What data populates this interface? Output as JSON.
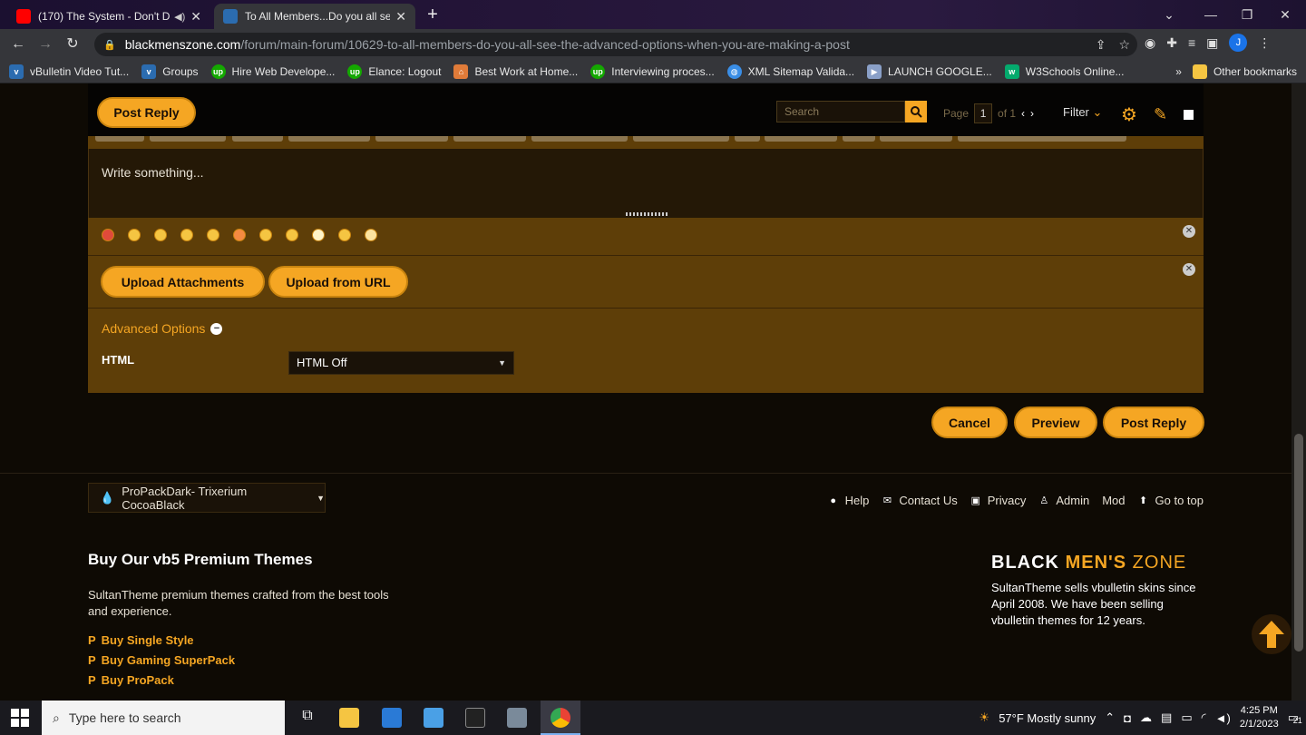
{
  "browser": {
    "tabs": [
      {
        "title": "(170) The System - Don't Dis",
        "state": "inactive",
        "favicon": "youtube-icon"
      },
      {
        "title": "To All Members...Do you all see th",
        "state": "active",
        "favicon": "vbulletin-icon"
      }
    ],
    "url_domain": "blackmenszone.com",
    "url_path": "/forum/main-forum/10629-to-all-members-do-you-all-see-the-advanced-options-when-you-are-making-a-post",
    "profile_initial": "J",
    "bookmarks": [
      {
        "label": "vBulletin Video Tut...",
        "icon": "vbulletin-icon",
        "color": "#2b6cb0"
      },
      {
        "label": "Groups",
        "icon": "vbulletin-icon",
        "color": "#2b6cb0"
      },
      {
        "label": "Hire Web Develope...",
        "icon": "upwork-icon",
        "color": "#14a800"
      },
      {
        "label": "Elance: Logout",
        "icon": "upwork-icon",
        "color": "#14a800"
      },
      {
        "label": "Best Work at Home...",
        "icon": "home-icon",
        "color": "#e07b39"
      },
      {
        "label": "Interviewing proces...",
        "icon": "upwork-icon",
        "color": "#14a800"
      },
      {
        "label": "XML Sitemap Valida...",
        "icon": "globe-icon",
        "color": "#3a8ee6"
      },
      {
        "label": "LAUNCH GOOGLE...",
        "icon": "flag-icon",
        "color": "#8aa0c8"
      },
      {
        "label": "W3Schools Online...",
        "icon": "w3schools-icon",
        "color": "#04aa6d"
      }
    ],
    "more_bookmarks": "»",
    "other_bookmarks": "Other bookmarks"
  },
  "forum": {
    "post_reply_top": "Post Reply",
    "search_placeholder": "Search",
    "page_label": "Page",
    "page_current": "1",
    "page_of": "of 1",
    "filter_label": "Filter",
    "editor_placeholder": "Write something...",
    "upload_attachments": "Upload Attachments",
    "upload_from_url": "Upload from URL",
    "advanced_options": "Advanced Options",
    "html_label": "HTML",
    "html_select_value": "HTML Off",
    "cancel": "Cancel",
    "preview": "Preview",
    "post_reply": "Post Reply"
  },
  "footer": {
    "style_selector": "ProPackDark- Trixerium CocoaBlack",
    "links": [
      {
        "label": "Help",
        "icon": "info-icon"
      },
      {
        "label": "Contact Us",
        "icon": "envelope-icon"
      },
      {
        "label": "Privacy",
        "icon": "lock-icon"
      },
      {
        "label": "Admin",
        "icon": "user-icon"
      },
      {
        "label": "Mod",
        "icon": ""
      },
      {
        "label": "Go to top",
        "icon": "arrow-up-circle-icon"
      }
    ],
    "buy_title": "Buy Our vb5 Premium Themes",
    "buy_desc": "SultanTheme premium themes crafted from the best tools and experience.",
    "buy_links": [
      "Buy Single Style",
      "Buy Gaming SuperPack",
      "Buy ProPack"
    ],
    "brand_part1": "BLACK",
    "brand_part2": "MEN'S",
    "brand_part3": "ZONE",
    "brand_desc": "SultanTheme sells vbulletin skins since April 2008. We have been selling vbulletin themes for 12 years."
  },
  "taskbar": {
    "search_placeholder": "Type here to search",
    "weather": "57°F  Mostly sunny",
    "time": "4:25 PM",
    "date": "2/1/2023",
    "notification_count": "21"
  },
  "colors": {
    "accent": "#f5a623",
    "panel": "#5e3e08",
    "background": "#0e0a04"
  }
}
